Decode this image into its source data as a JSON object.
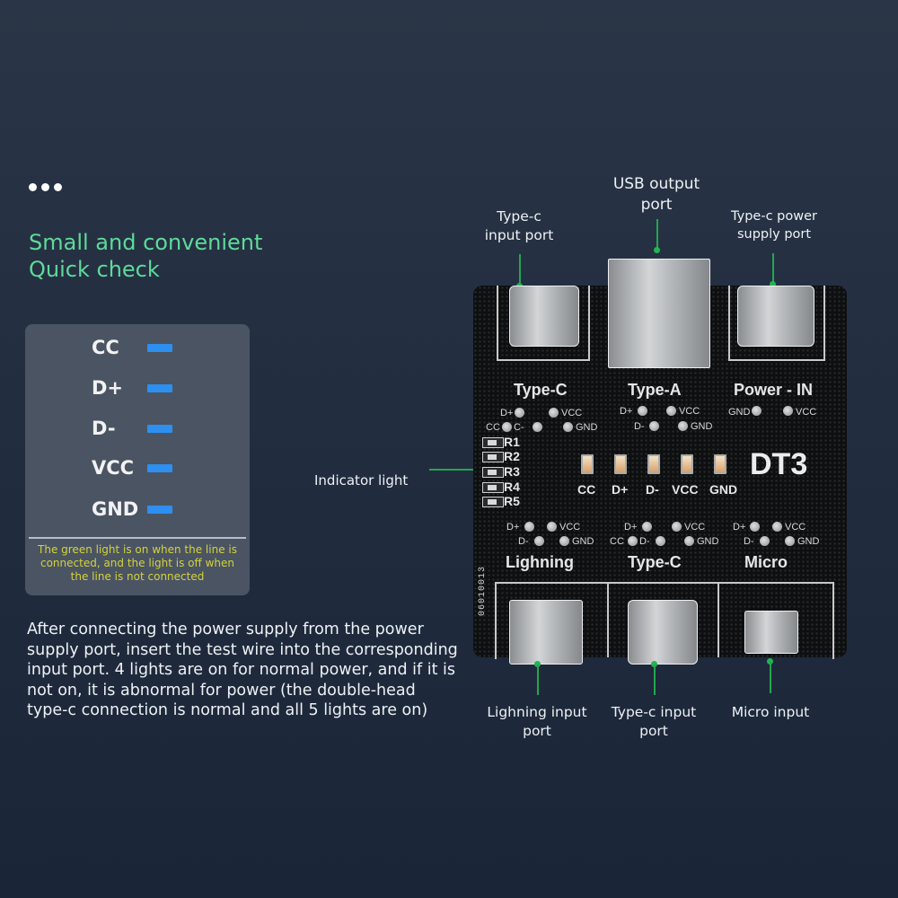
{
  "intro": {
    "dots_icon": "ellipsis-icon",
    "headline_line1": "Small and convenient",
    "headline_line2": "Quick check"
  },
  "legend": {
    "items": [
      {
        "label": "CC",
        "color": "#2d8ff0"
      },
      {
        "label": "D+",
        "color": "#2d8ff0"
      },
      {
        "label": "D-",
        "color": "#2d8ff0"
      },
      {
        "label": "VCC",
        "color": "#2d8ff0"
      },
      {
        "label": "GND",
        "color": "#2d8ff0"
      }
    ],
    "note": "The green light is on when the line is connected, and the light is off when the line is not connected"
  },
  "description": "After connecting the power supply from the power supply port, insert the test wire into the corresponding input port. 4 lights are on for normal power, and if it is not on, it is abnormal for power (the double-head type-c connection is normal and all 5 lights are on)",
  "callouts": {
    "type_c_input_top": [
      "Type-c",
      "input port"
    ],
    "usb_output": [
      "USB output",
      "port"
    ],
    "type_c_power": [
      "Type-c power",
      "supply port"
    ],
    "indicator_light": "Indicator light",
    "lightning_input": [
      "Lighning input",
      "port"
    ],
    "type_c_input_bottom": [
      "Type-c input",
      "port"
    ],
    "micro_input": "Micro input"
  },
  "board": {
    "model": "DT3",
    "serial": "06010013",
    "top_sections": [
      {
        "title": "Type-C",
        "pads": [
          "D+",
          "VCC",
          "CC",
          "C-",
          "GND"
        ]
      },
      {
        "title": "Type-A",
        "pads": [
          "D+",
          "VCC",
          "D-",
          "GND"
        ]
      },
      {
        "title": "Power - IN",
        "pads": [
          "GND",
          "VCC"
        ]
      }
    ],
    "resistors": [
      "R1",
      "R2",
      "R3",
      "R4",
      "R5"
    ],
    "leds": [
      "CC",
      "D+",
      "D-",
      "VCC",
      "GND"
    ],
    "bottom_sections": [
      {
        "title": "Lighning",
        "pads": [
          "D+",
          "VCC",
          "D-",
          "GND"
        ]
      },
      {
        "title": "Type-C",
        "pads": [
          "D+",
          "VCC",
          "CC",
          "D-",
          "GND"
        ]
      },
      {
        "title": "Micro",
        "pads": [
          "D+",
          "VCC",
          "D-",
          "GND"
        ]
      }
    ]
  }
}
